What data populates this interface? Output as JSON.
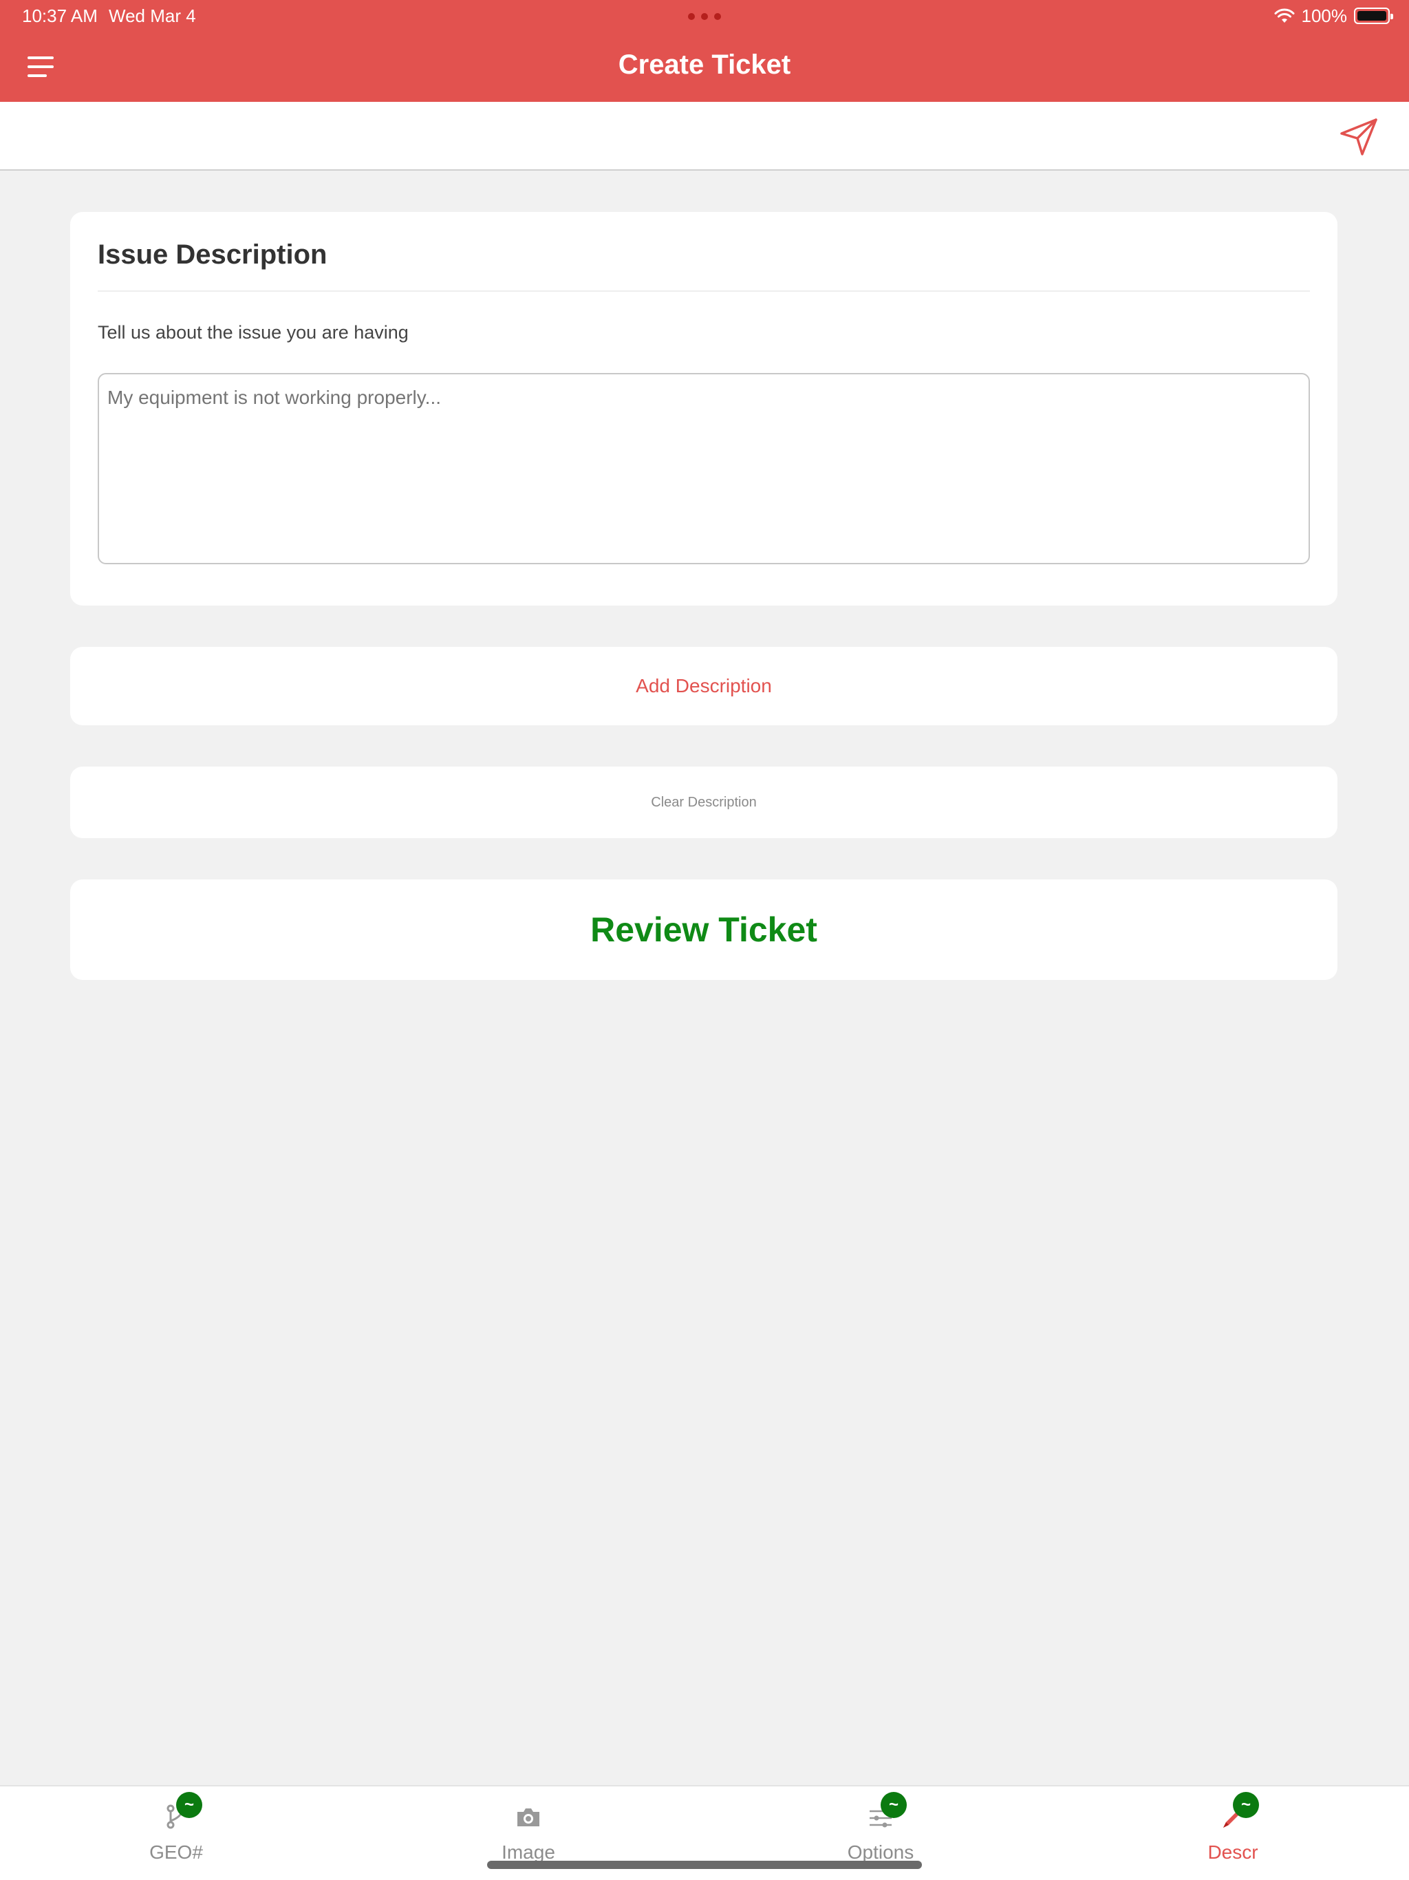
{
  "status_bar": {
    "time": "10:37 AM",
    "date": "Wed Mar 4",
    "battery": "100%",
    "icons": [
      "wifi-icon",
      "battery-icon"
    ]
  },
  "header": {
    "title": "Create Ticket",
    "menu_icon": "hamburger-menu-icon",
    "color": "#e2524f"
  },
  "toolbar": {
    "send_icon": "paper-plane-send-icon"
  },
  "issue_card": {
    "title": "Issue Description",
    "subtitle": "Tell us about the issue you are having",
    "placeholder": "My equipment is not working properly...",
    "value": ""
  },
  "buttons": {
    "add_description": "Add Description",
    "clear_description": "Clear Description",
    "review_ticket": "Review Ticket",
    "review_color": "#0f8a16"
  },
  "tabs": [
    {
      "label": "GEO#",
      "icon": "location-pin-icon",
      "badge": "~",
      "active": false
    },
    {
      "label": "Image",
      "icon": "camera-icon",
      "badge": "",
      "active": false
    },
    {
      "label": "Options",
      "icon": "sliders-icon",
      "badge": "~",
      "active": false
    },
    {
      "label": "Descr",
      "icon": "pencil-icon",
      "badge": "~",
      "active": true
    }
  ]
}
